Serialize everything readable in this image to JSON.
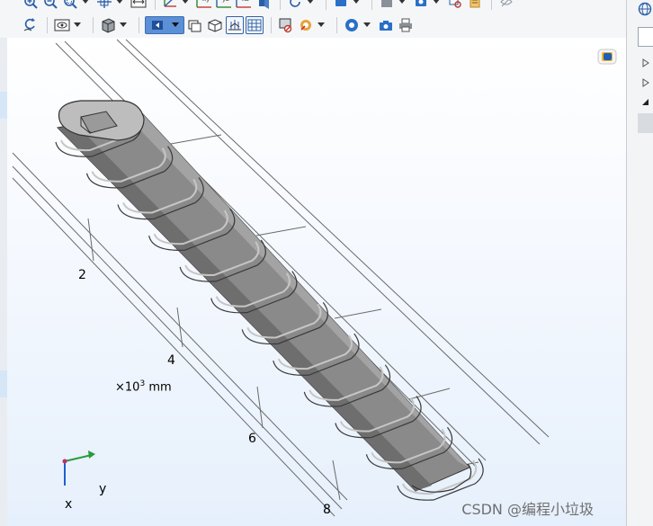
{
  "toolbar": {
    "row1_icons": [
      "zoom-in-icon",
      "zoom-out-icon",
      "zoom-box-icon",
      "zoom-extents-icon",
      "go-to-default-view-icon",
      "transparency-icon",
      "axes-xy-icon",
      "axes-yz-icon",
      "axes-xz-icon",
      "scene-light-icon",
      "rotate-view-icon",
      "select-icon",
      "render-icon",
      "import-image-icon",
      "highlight-icon",
      "settings-icon"
    ],
    "row2_icons": [
      "reset-hiding-icon",
      "view-icon",
      "box-icon",
      "wireframe-icon",
      "light-icon",
      "transparency-2-icon",
      "show-grid-icon",
      "show-edges-icon",
      "mesh-icon",
      "clear-selection-icon",
      "colors-icon",
      "aperture-icon",
      "camera-icon",
      "print-icon"
    ],
    "plane_labels": {
      "xy": "xy",
      "yz": "yz",
      "xz": "xz"
    }
  },
  "graphics": {
    "axis_ticks": [
      "2",
      "4",
      "6",
      "8"
    ],
    "scale_base": "×10",
    "scale_exp": "3",
    "scale_unit": "mm",
    "triad": {
      "y": "y",
      "x": "x"
    },
    "model_color": "#8a8a8a",
    "background_bottom": "#e6f0fc"
  },
  "watermark": "CSDN @编程小垃圾"
}
